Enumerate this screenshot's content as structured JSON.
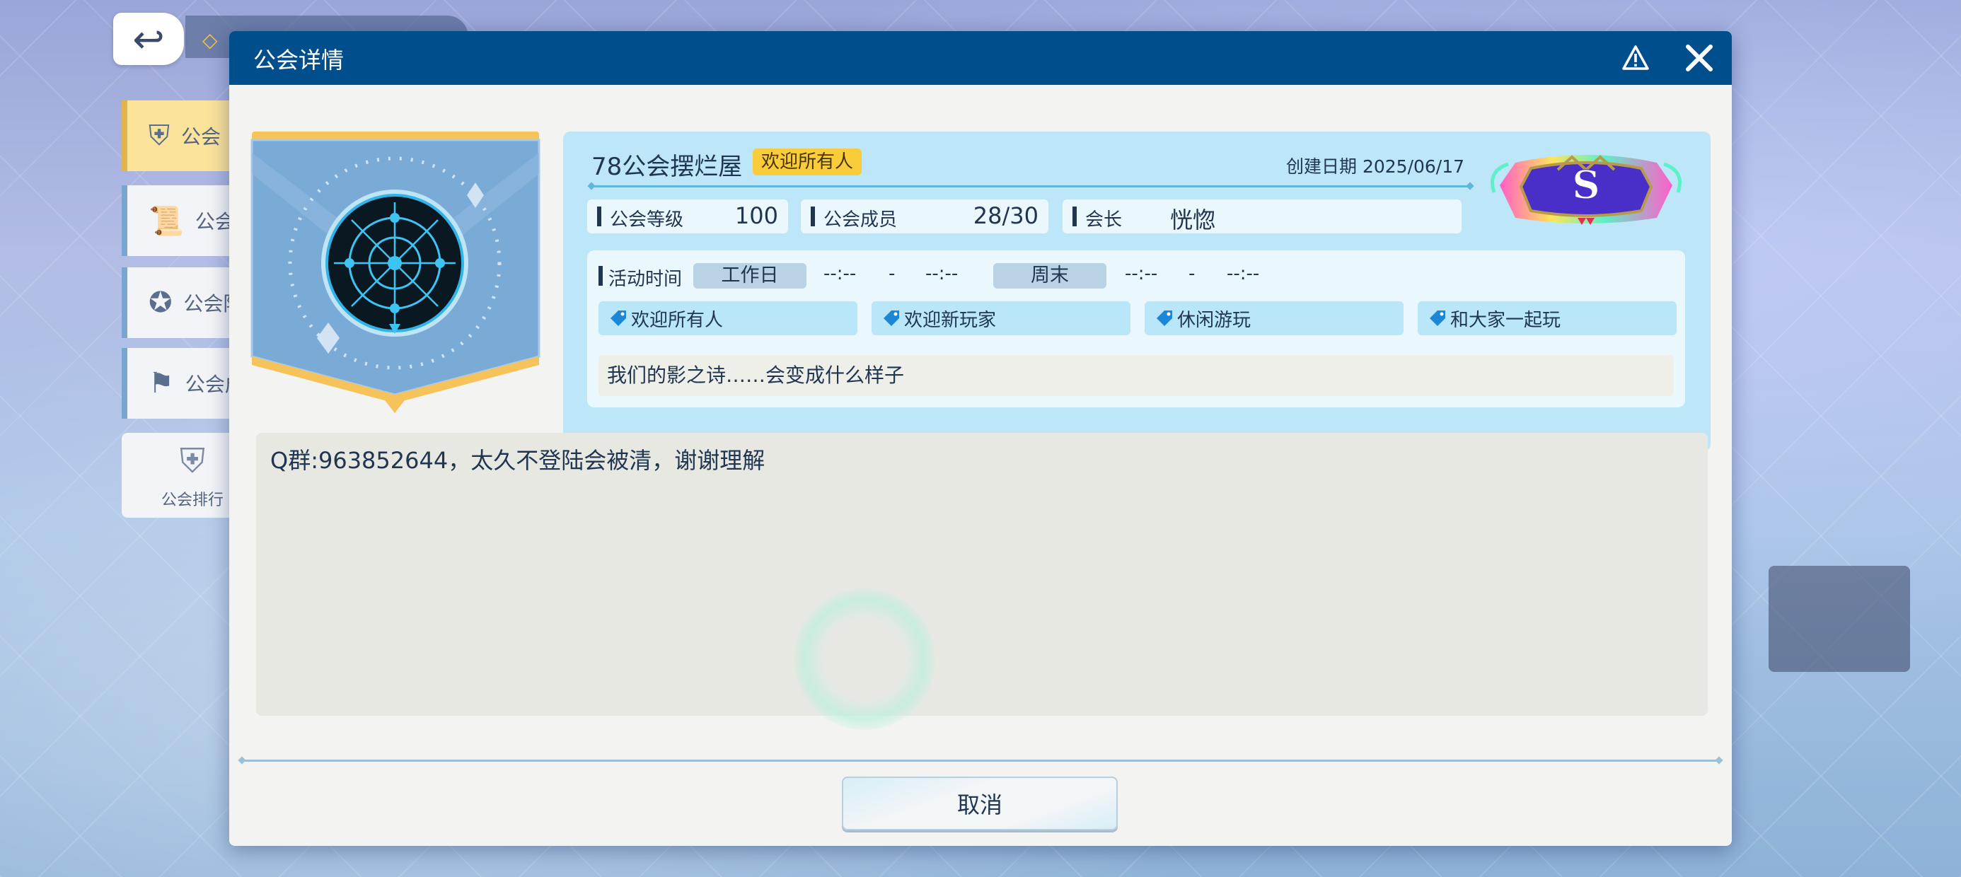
{
  "nav": {
    "items": [
      {
        "label": "公会",
        "icon": "shield-icon"
      },
      {
        "label": "公会任",
        "icon": "scroll-icon"
      },
      {
        "label": "公会阶",
        "icon": "ribbon-icon"
      },
      {
        "label": "公会成",
        "icon": "flag-icon"
      }
    ],
    "rank_label": "公会排行"
  },
  "dialog": {
    "title": "公会详情"
  },
  "guild": {
    "name": "78公会摆烂屋",
    "welcome_badge": "欢迎所有人",
    "create_date": "创建日期 2025/06/17",
    "rank_letter": "S",
    "stats": {
      "level_label": "公会等级",
      "level_value": "100",
      "members_label": "公会成员",
      "members_value": "28/30",
      "leader_label": "会长",
      "leader_value": "恍惚"
    },
    "activity": {
      "label": "活动时间",
      "weekday_label": "工作日",
      "weekday_start": "--:--",
      "weekday_sep": "-",
      "weekday_end": "--:--",
      "weekend_label": "周末",
      "weekend_start": "--:--",
      "weekend_sep": "-",
      "weekend_end": "--:--"
    },
    "tags": [
      "欢迎所有人",
      "欢迎新玩家",
      "休闲游玩",
      "和大家一起玩"
    ],
    "motto": "我们的影之诗……会变成什么样子",
    "notice": "Q群:963852644，太久不登陆会被清，谢谢理解"
  },
  "buttons": {
    "cancel": "取消"
  },
  "colors": {
    "header": "#004f8c",
    "panel": "#bde6f8",
    "badge": "#f9cc3b",
    "banner": "#7aaad6",
    "banner_trim": "#f6c35a"
  }
}
